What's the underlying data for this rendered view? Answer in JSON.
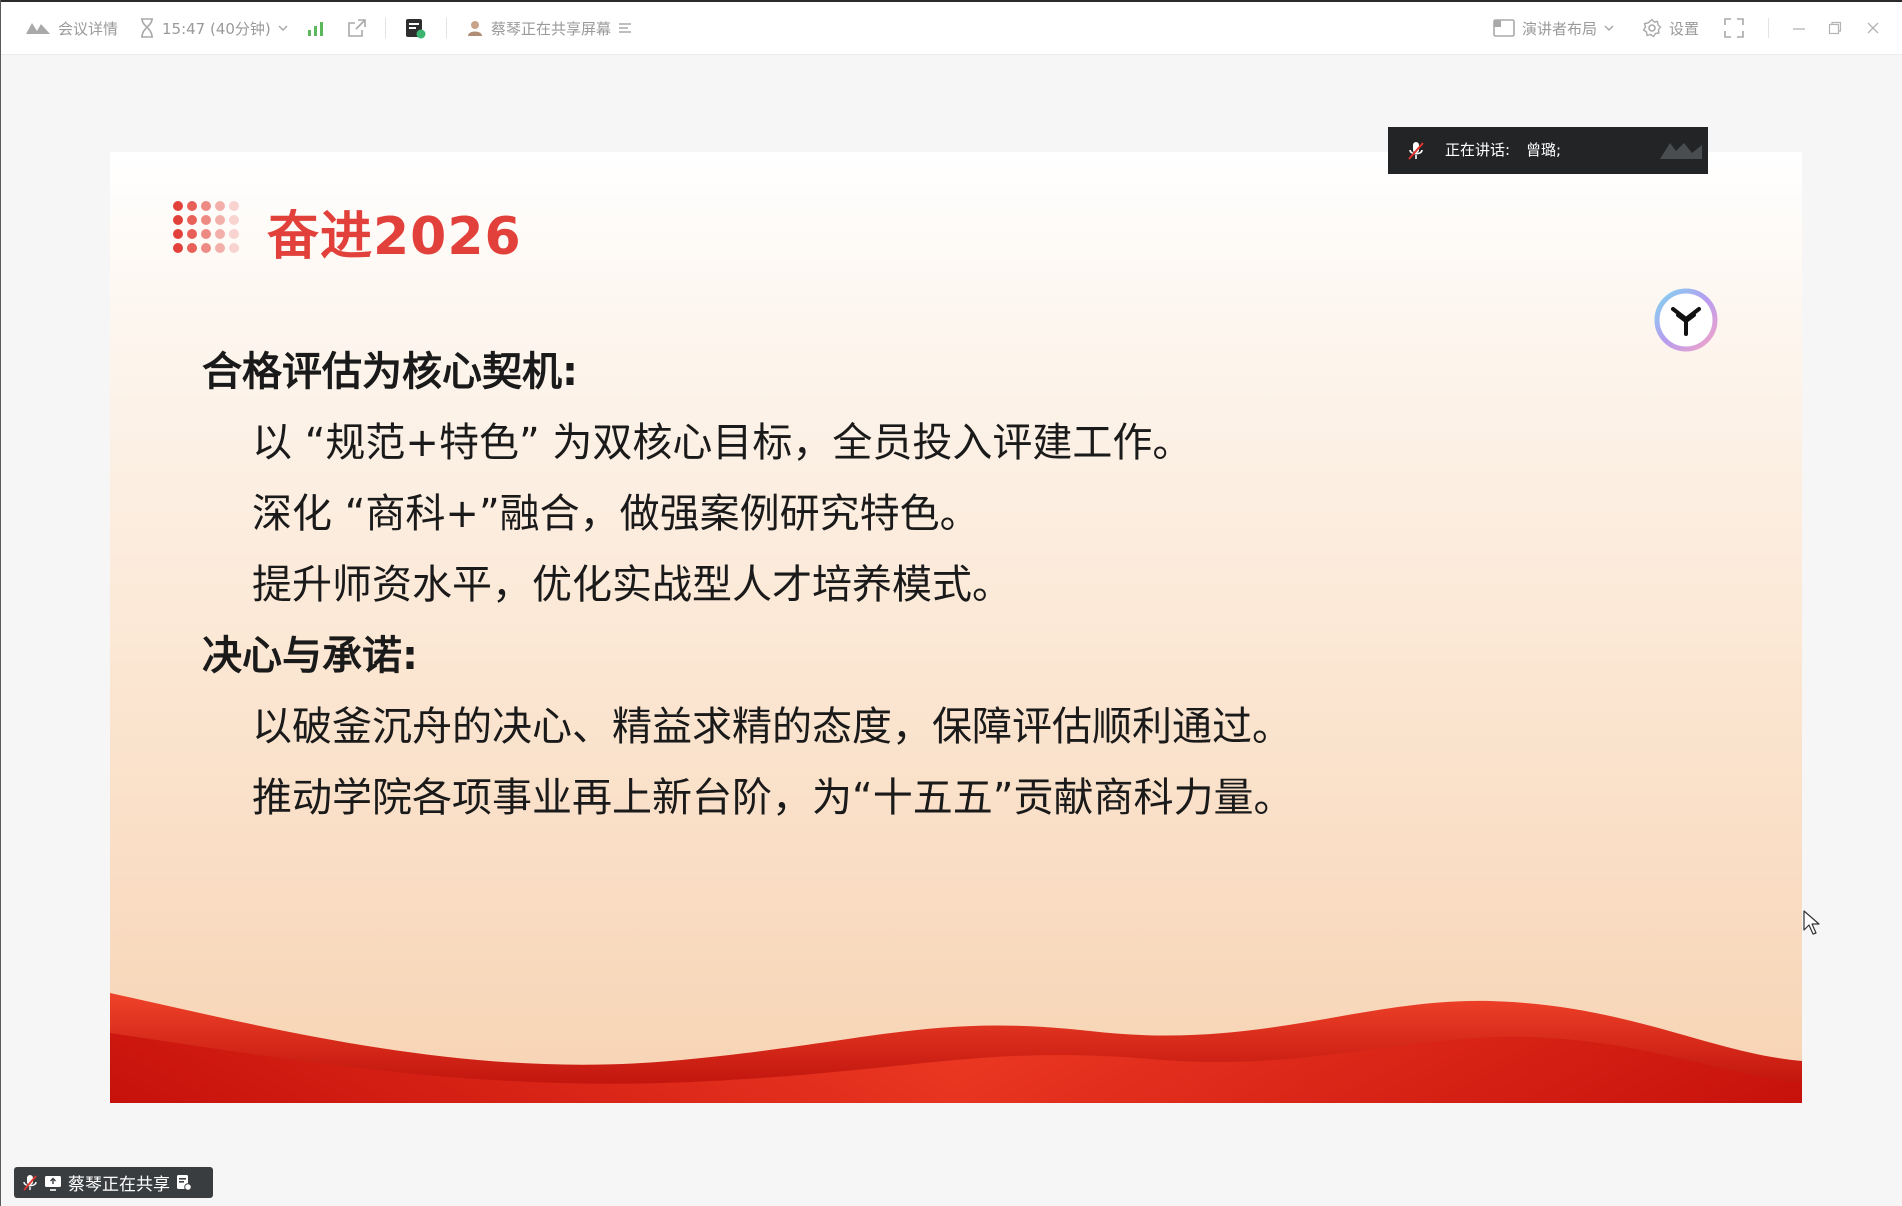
{
  "topbar": {
    "meeting_details": "会议详情",
    "timer": "15:47 (40分钟)",
    "sharing_status": "蔡琴正在共享屏幕",
    "presenter_layout": "演讲者布局",
    "settings": "设置"
  },
  "speaking": {
    "label": "正在讲话:",
    "speaker": "曾璐;"
  },
  "slide": {
    "title": "奋进2026",
    "sections": [
      {
        "heading": "合格评估为核心契机:",
        "lines": [
          "以 “规范+特色” 为双核心目标，全员投入评建工作。",
          "深化 “商科+”融合，做强案例研究特色。",
          "提升师资水平，优化实战型人才培养模式。"
        ]
      },
      {
        "heading": "决心与承诺:",
        "lines": [
          "以破釜沉舟的决心、精益求精的态度，保障评估顺利通过。",
          "推动学院各项事业再上新台阶，为“十五五”贡献商科力量。"
        ]
      }
    ]
  },
  "share_pill": {
    "label": "蔡琴正在共享"
  },
  "colors": {
    "title_red": "#e2413b",
    "wave_red": "#d8160e",
    "speaking_bg": "#222426"
  }
}
